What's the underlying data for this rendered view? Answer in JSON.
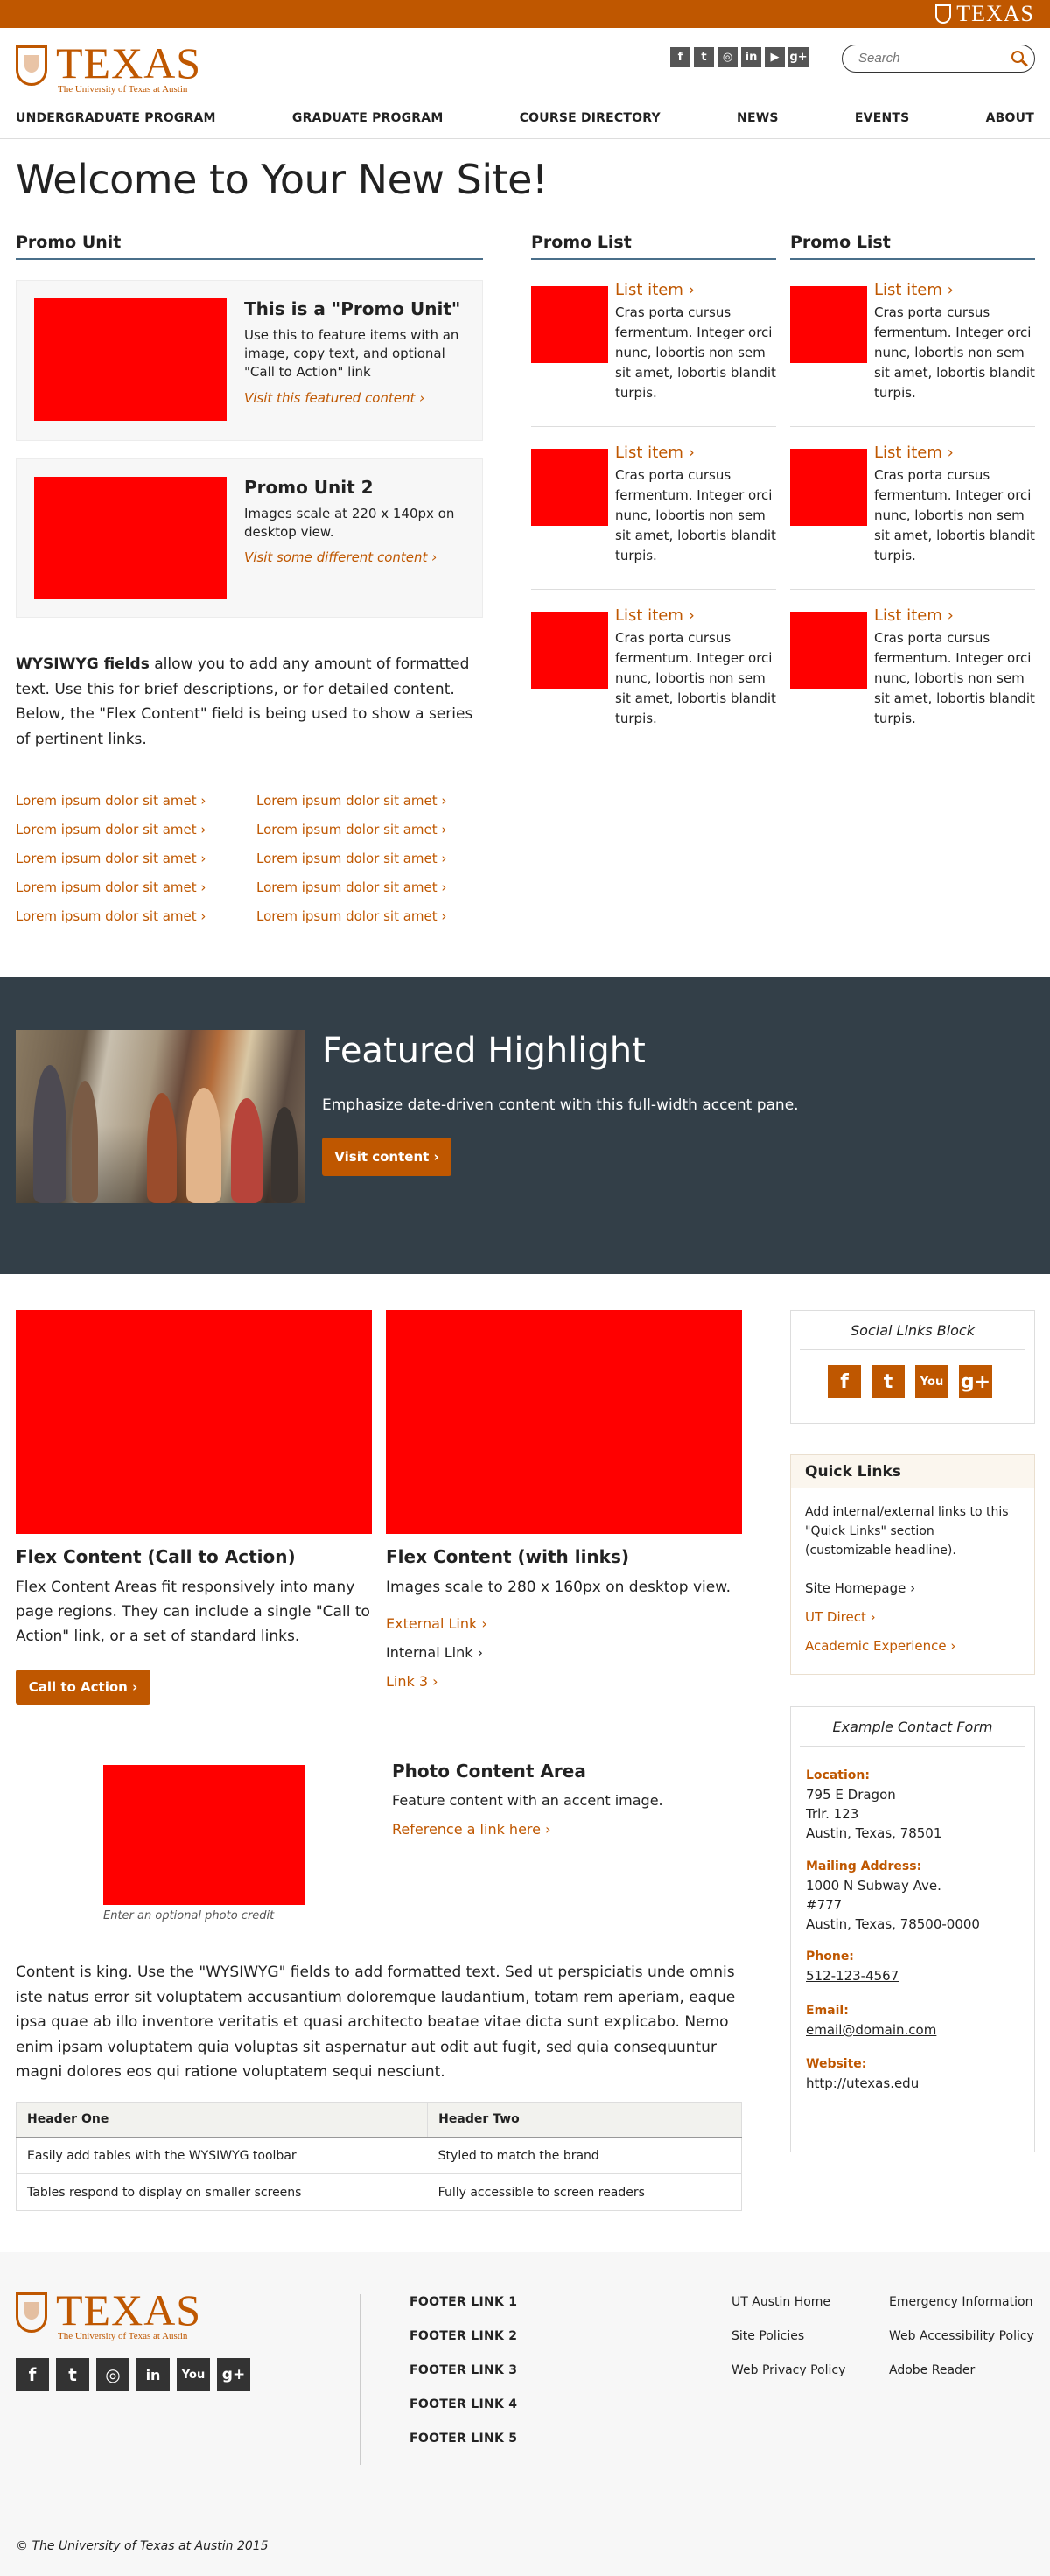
{
  "topbar": {
    "wordmark": "TEXAS"
  },
  "header": {
    "logo_word": "TEXAS",
    "logo_sub": "The University of Texas at Austin",
    "social_icons": [
      {
        "name": "facebook-icon",
        "glyph": "f"
      },
      {
        "name": "twitter-icon",
        "glyph": "t"
      },
      {
        "name": "instagram-icon",
        "glyph": "◎"
      },
      {
        "name": "linkedin-icon",
        "glyph": "in"
      },
      {
        "name": "youtube-icon",
        "glyph": "▶"
      },
      {
        "name": "googleplus-icon",
        "glyph": "g+"
      }
    ],
    "search_placeholder": "Search"
  },
  "nav": [
    "UNDERGRADUATE PROGRAM",
    "GRADUATE PROGRAM",
    "COURSE DIRECTORY",
    "NEWS",
    "EVENTS",
    "ABOUT"
  ],
  "page_title": "Welcome to Your New Site!",
  "promo_unit": {
    "heading": "Promo Unit",
    "items": [
      {
        "title": "This is a \"Promo Unit\"",
        "desc": "Use this to feature items with an image, copy text, and optional \"Call to Action\" link",
        "cta": "Visit this featured content ›"
      },
      {
        "title": "Promo Unit 2",
        "desc": "Images scale at 220 x 140px on desktop view.",
        "cta": "Visit some different content ›"
      }
    ]
  },
  "promo_list_heading": "Promo List",
  "promo_list_item": {
    "title": "List item ›",
    "desc": "Cras porta cursus fermentum. Integer orci nunc, lobortis non sem sit amet, lobortis blandit turpis."
  },
  "wysiwyg1": {
    "bold": "WYSIWYG fields",
    "text": " allow you to add any amount of formatted text. Use this for brief descriptions, or for detailed content. Below, the \"Flex Content\" field is being used to show a series of pertinent links."
  },
  "lorem_link": "Lorem ipsum dolor sit amet ›",
  "featured": {
    "title": "Featured Highlight",
    "desc": "Emphasize date-driven content with this full-width accent pane.",
    "button": "Visit content ›"
  },
  "flex1": {
    "title": "Flex Content (Call to Action)",
    "desc": "Flex Content Areas fit responsively into many page regions. They can include a single \"Call to Action\" link, or a set of standard links.",
    "button": "Call to Action ›"
  },
  "flex2": {
    "title": "Flex Content (with links)",
    "desc": "Images scale to 280 x 160px on desktop view.",
    "links": [
      "External Link ›",
      "Internal Link ›",
      "Link 3 ›"
    ]
  },
  "photo_area": {
    "credit": "Enter an optional photo credit",
    "title": "Photo Content Area",
    "desc": "Feature content with an accent image.",
    "link": "Reference a link here ›"
  },
  "wysiwyg2": "Content is king. Use the \"WYSIWYG\" fields to add formatted text. Sed ut perspiciatis unde omnis iste natus error sit voluptatem accusantium doloremque laudantium, totam rem aperiam, eaque ipsa quae ab illo inventore veritatis et quasi architecto beatae vitae dicta sunt explicabo. Nemo enim ipsam voluptatem quia voluptas sit aspernatur aut odit aut fugit, sed quia consequuntur magni dolores eos qui ratione voluptatem sequi nesciunt.",
  "table": {
    "headers": [
      "Header One",
      "Header Two"
    ],
    "rows": [
      [
        "Easily add tables with the WYSIWYG toolbar",
        "Styled to match the brand"
      ],
      [
        "Tables respond to display on smaller screens",
        "Fully accessible to screen readers"
      ]
    ]
  },
  "sidebar": {
    "social_title": "Social Links Block",
    "quick_links": {
      "title": "Quick Links",
      "desc": "Add internal/external links to this \"Quick Links\" section (customizable headline).",
      "links": [
        "Site Homepage ›",
        "UT Direct ›",
        "Academic Experience ›"
      ]
    },
    "contact": {
      "title": "Example Contact Form",
      "location_label": "Location:",
      "location": [
        "795 E Dragon",
        "Trlr. 123",
        "Austin, Texas, 78501"
      ],
      "mailing_label": "Mailing Address:",
      "mailing": [
        "1000 N Subway Ave.",
        "#777",
        "Austin, Texas, 78500-0000"
      ],
      "phone_label": "Phone:",
      "phone": "512-123-4567",
      "email_label": "Email:",
      "email": "email@domain.com",
      "website_label": "Website:",
      "website": "http://utexas.edu"
    }
  },
  "footer": {
    "links": [
      "FOOTER LINK 1",
      "FOOTER LINK 2",
      "FOOTER LINK 3",
      "FOOTER LINK 4",
      "FOOTER LINK 5"
    ],
    "right_col1": [
      "UT Austin Home",
      "Site Policies",
      "Web Privacy Policy"
    ],
    "right_col2": [
      "Emergency Information",
      "Web Accessibility Policy",
      "Adobe Reader"
    ],
    "copyright": "© The University of Texas at Austin 2015"
  },
  "colors": {
    "brand": "#bf5700",
    "dark_pane": "#333f48",
    "placeholder": "#ff0000"
  }
}
